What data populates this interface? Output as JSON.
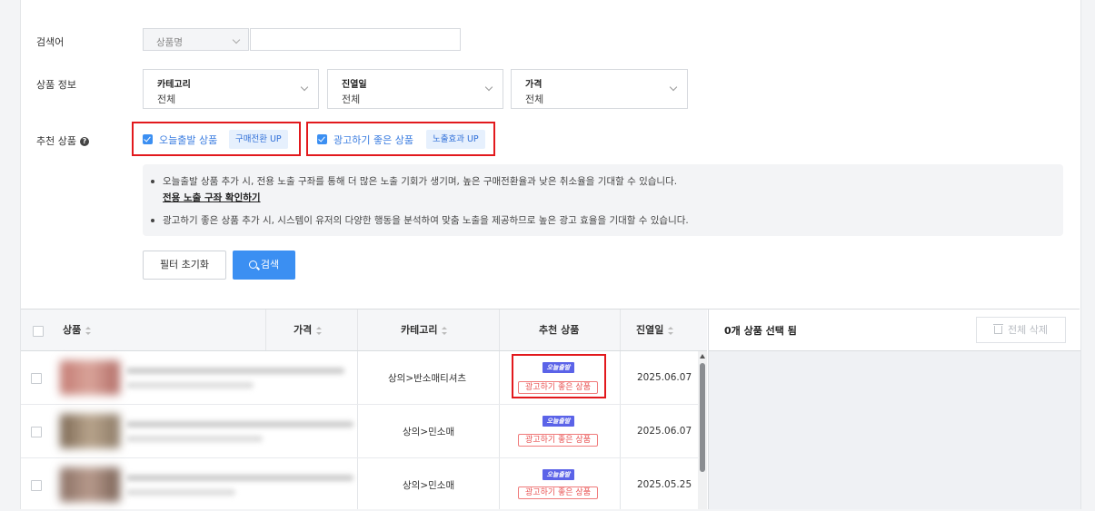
{
  "filters": {
    "keyword_label": "검색어",
    "keyword_type": "상품명",
    "keyword_value": "",
    "product_info_label": "상품 정보",
    "dropdowns": [
      {
        "title": "카테고리",
        "value": "전체"
      },
      {
        "title": "진열일",
        "value": "전체"
      },
      {
        "title": "가격",
        "value": "전체"
      }
    ],
    "recommend_label": "추천 상품",
    "recommend_options": [
      {
        "label": "오늘출발 상품",
        "tag": "구매전환 UP",
        "checked": true
      },
      {
        "label": "광고하기 좋은 상품",
        "tag": "노출효과 UP",
        "checked": true
      }
    ],
    "info": {
      "line1": "오늘출발 상품 추가 시, 전용 노출 구좌를 통해 더 많은 노출 기회가 생기며, 높은 구매전환율과 낮은 취소율을 기대할 수 있습니다.",
      "link": "전용 노출 구좌 확인하기",
      "line2": "광고하기 좋은 상품 추가 시, 시스템이 유저의 다양한 행동을 분석하여 맞춤 노출을 제공하므로 높은 광고 효율을 기대할 수 있습니다."
    },
    "reset_button": "필터 초기화",
    "search_button": "검색"
  },
  "table": {
    "headers": {
      "product": "상품",
      "price": "가격",
      "category": "카테고리",
      "recommend": "추천 상품",
      "display_date": "진열일"
    },
    "rows": [
      {
        "category": "상의>반소매티셔츠",
        "badge_today": "오늘출발",
        "badge_ad": "광고하기 좋은 상품",
        "date": "2025.06.07"
      },
      {
        "category": "상의>민소매",
        "badge_today": "오늘출발",
        "badge_ad": "광고하기 좋은 상품",
        "date": "2025.06.07"
      },
      {
        "category": "상의>민소매",
        "badge_today": "오늘출발",
        "badge_ad": "광고하기 좋은 상품",
        "date": "2025.05.25"
      }
    ]
  },
  "selection": {
    "count_text": "0개 상품 선택 됨",
    "delete_all": "전체 삭제"
  }
}
